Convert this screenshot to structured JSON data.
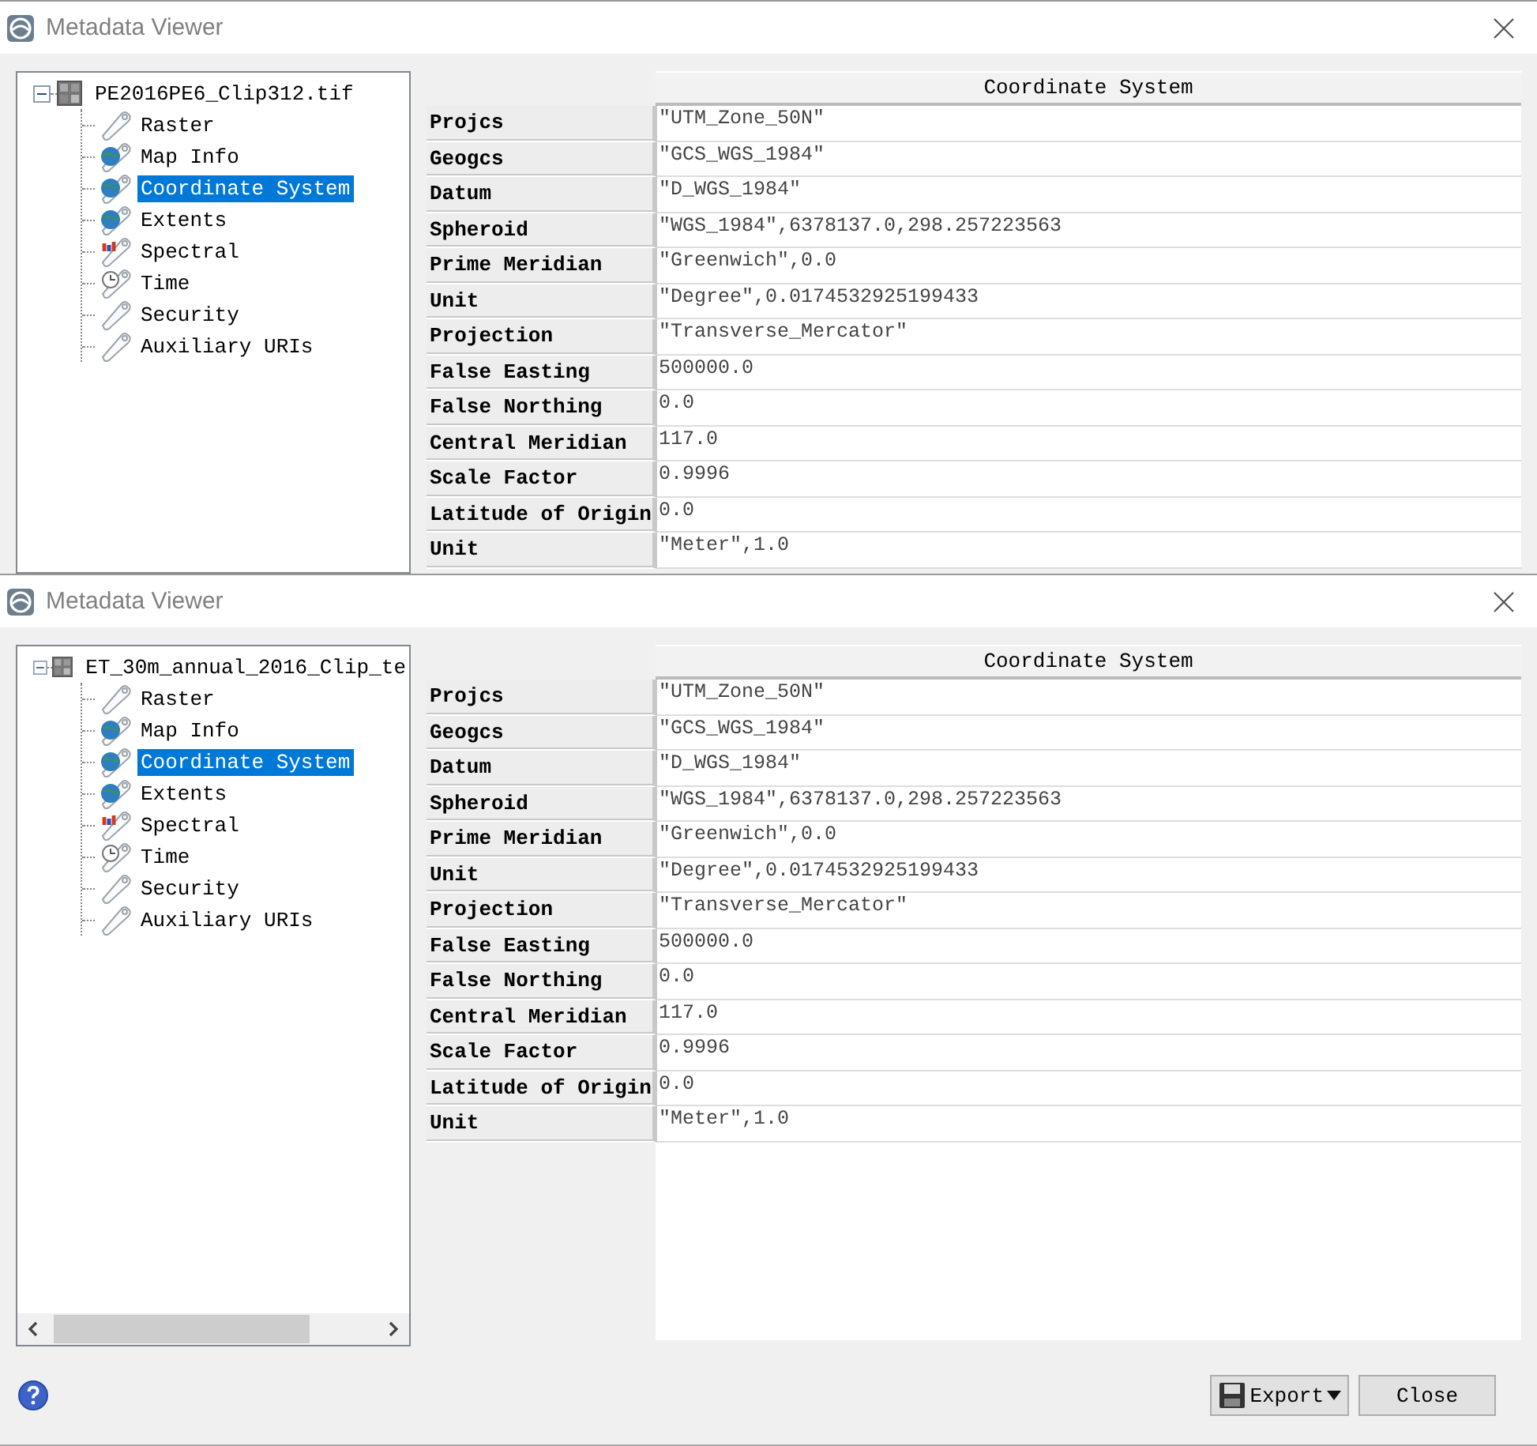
{
  "windows": [
    {
      "title": "Metadata Viewer",
      "tree": {
        "label": "PE2016PE6_Clip312.tif",
        "expanded": true,
        "children": [
          {
            "label": "Raster",
            "kind": "blank",
            "selected": false
          },
          {
            "label": "Map Info",
            "kind": "globe",
            "selected": false
          },
          {
            "label": "Coordinate System",
            "kind": "globe",
            "selected": true
          },
          {
            "label": "Extents",
            "kind": "globe",
            "selected": false
          },
          {
            "label": "Spectral",
            "kind": "spectral",
            "selected": false
          },
          {
            "label": "Time",
            "kind": "clock",
            "selected": false
          },
          {
            "label": "Security",
            "kind": "blank",
            "selected": false
          },
          {
            "label": "Auxiliary URIs",
            "kind": "blank",
            "selected": false
          }
        ]
      },
      "table": {
        "heading": "Coordinate System",
        "rows": [
          {
            "name": "Projcs",
            "value": "\"UTM_Zone_50N\""
          },
          {
            "name": "Geogcs",
            "value": "\"GCS_WGS_1984\""
          },
          {
            "name": "Datum",
            "value": "\"D_WGS_1984\""
          },
          {
            "name": "Spheroid",
            "value": "\"WGS_1984\",6378137.0,298.257223563"
          },
          {
            "name": "Prime Meridian",
            "value": "\"Greenwich\",0.0"
          },
          {
            "name": "Unit",
            "value": "\"Degree\",0.0174532925199433"
          },
          {
            "name": "Projection",
            "value": "\"Transverse_Mercator\""
          },
          {
            "name": "False Easting",
            "value": "500000.0"
          },
          {
            "name": "False Northing",
            "value": "0.0"
          },
          {
            "name": "Central Meridian",
            "value": "117.0"
          },
          {
            "name": "Scale Factor",
            "value": "0.9996"
          },
          {
            "name": "Latitude of Origin",
            "value": "0.0"
          },
          {
            "name": "Unit",
            "value": "\"Meter\",1.0"
          }
        ]
      }
    },
    {
      "title": "Metadata Viewer",
      "tree": {
        "label": "ET_30m_annual_2016_Clip_te",
        "expanded": true,
        "children": [
          {
            "label": "Raster",
            "kind": "blank",
            "selected": false
          },
          {
            "label": "Map Info",
            "kind": "globe",
            "selected": false
          },
          {
            "label": "Coordinate System",
            "kind": "globe",
            "selected": true
          },
          {
            "label": "Extents",
            "kind": "globe",
            "selected": false
          },
          {
            "label": "Spectral",
            "kind": "spectral",
            "selected": false
          },
          {
            "label": "Time",
            "kind": "clock",
            "selected": false
          },
          {
            "label": "Security",
            "kind": "blank",
            "selected": false
          },
          {
            "label": "Auxiliary URIs",
            "kind": "blank",
            "selected": false
          }
        ]
      },
      "horizontal_scrollbar": true,
      "table": {
        "heading": "Coordinate System",
        "rows": [
          {
            "name": "Projcs",
            "value": "\"UTM_Zone_50N\""
          },
          {
            "name": "Geogcs",
            "value": "\"GCS_WGS_1984\""
          },
          {
            "name": "Datum",
            "value": "\"D_WGS_1984\""
          },
          {
            "name": "Spheroid",
            "value": "\"WGS_1984\",6378137.0,298.257223563"
          },
          {
            "name": "Prime Meridian",
            "value": "\"Greenwich\",0.0"
          },
          {
            "name": "Unit",
            "value": "\"Degree\",0.0174532925199433"
          },
          {
            "name": "Projection",
            "value": "\"Transverse_Mercator\""
          },
          {
            "name": "False Easting",
            "value": "500000.0"
          },
          {
            "name": "False Northing",
            "value": "0.0"
          },
          {
            "name": "Central Meridian",
            "value": "117.0"
          },
          {
            "name": "Scale Factor",
            "value": "0.9996"
          },
          {
            "name": "Latitude of Origin",
            "value": "0.0"
          },
          {
            "name": "Unit",
            "value": "\"Meter\",1.0"
          }
        ]
      },
      "footer": {
        "buttons": [
          {
            "label": "Export",
            "kind": "menu"
          },
          {
            "label": "Close",
            "kind": "plain"
          }
        ]
      }
    }
  ]
}
